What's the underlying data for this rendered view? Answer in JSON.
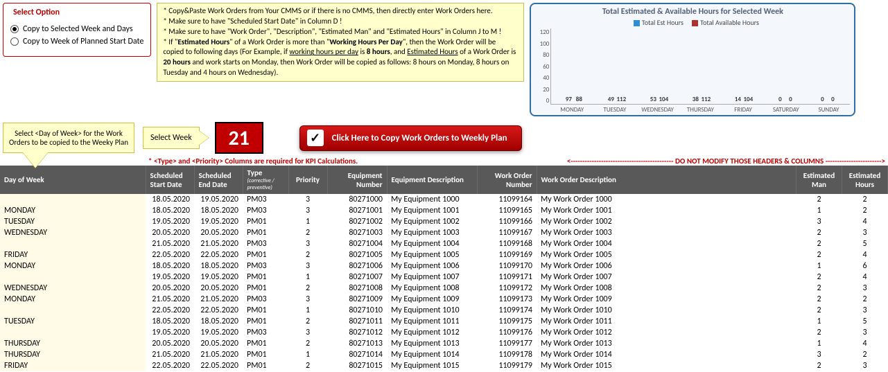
{
  "option_box": {
    "legend": "Select Option",
    "opt1": "Copy to Selected Week and Days",
    "opt2": "Copy to Week of Planned Start Date"
  },
  "instructions": {
    "l1": "* Copy&Paste Work Orders from Your CMMS or if there is no CMMS, then directly enter Work Orders here.",
    "l2": "* Make sure to have \"Scheduled Start Date\" in Column D !",
    "l3": "* Make sure to have \"Work Order\", \"Description\", \"Estimated Man\" and \"Estimated Hours\" in Column J to M !",
    "l4a": "* If \"",
    "l4b": "Estimated Hours",
    "l4c": "\" of a Work Order is more than \"",
    "l4d": "Working Hours Per Day",
    "l4e": "\", then the Work Order will be copied to following days (For Example, if ",
    "l4f": "working hours per day",
    "l4g": " is ",
    "l4h": "8 hours",
    "l4i": ", and ",
    "l4j": "Estimated Hours",
    "l4k": " of a Work Order is ",
    "l4l": "20 hours",
    "l4m": " and work starts on Monday, then Work Order will be copied as follows: 8 hours on Monday, 8 hours on Tuesday and 4 hours on Wednesday)."
  },
  "chart": {
    "title": "Total Estimated & Available Hours for Selected Week",
    "legend_a": "Total Est Hours",
    "legend_b": "Total Available Hours"
  },
  "chart_data": {
    "type": "bar",
    "categories": [
      "MONDAY",
      "TUESDAY",
      "WEDNESDAY",
      "THURSDAY",
      "FRIDAY",
      "SATURDAY",
      "SUNDAY"
    ],
    "series": [
      {
        "name": "Total Est Hours",
        "values": [
          97,
          49,
          53,
          38,
          14,
          0,
          0
        ],
        "color": "#2f8fd6"
      },
      {
        "name": "Total Available Hours",
        "values": [
          88,
          112,
          104,
          112,
          104,
          0,
          0
        ],
        "color": "#b03030"
      }
    ],
    "ylim": [
      0,
      120
    ],
    "yticks": [
      0,
      20,
      40,
      60,
      80,
      100,
      120
    ]
  },
  "day_arrow": "Select <Day of Week> for the Work Orders to be copied to the Weeky Plan",
  "select_week_label": "Select Week",
  "week_number": "21",
  "big_button": "Click Here to Copy Work Orders to Weekly Plan",
  "warn_left": "* <Type> and <Priority> Columns are required for KPI Calculations.",
  "warn_right_dash_l": "<--------------------------------------------",
  "warn_right_text": " DO NOT MODIFY THOSE HEADERS & COLUMNS ",
  "warn_right_dash_r": "------------------------>",
  "headers": {
    "day": "Day of Week",
    "ssd": "Scheduled Start Date",
    "sed": "Scheduled End Date",
    "type": "Type",
    "type_sub": "(corrective / preventive)",
    "prio": "Priority",
    "eqn": "Equipment Number",
    "eqd": "Equipment Description",
    "won": "Work Order Number",
    "wod": "Work Order Description",
    "man": "Estimated Man",
    "hrs": "Estimated Hours"
  },
  "rows": [
    {
      "day": "",
      "ssd": "18.05.2020",
      "sed": "19.05.2020",
      "type": "PM03",
      "prio": "3",
      "eqn": "80271000",
      "eqd": "My Equipment 1000",
      "won": "11099164",
      "wod": "My Work Order 1000",
      "man": "2",
      "hrs": "2"
    },
    {
      "day": "MONDAY",
      "ssd": "18.05.2020",
      "sed": "18.05.2020",
      "type": "PM03",
      "prio": "3",
      "eqn": "80271001",
      "eqd": "My Equipment 1001",
      "won": "11099165",
      "wod": "My Work Order 1001",
      "man": "1",
      "hrs": "2"
    },
    {
      "day": "TUESDAY",
      "ssd": "19.05.2020",
      "sed": "19.05.2020",
      "type": "PM01",
      "prio": "1",
      "eqn": "80271002",
      "eqd": "My Equipment 1002",
      "won": "11099166",
      "wod": "My Work Order 1002",
      "man": "3",
      "hrs": "4"
    },
    {
      "day": "WEDNESDAY",
      "ssd": "20.05.2020",
      "sed": "20.05.2020",
      "type": "PM01",
      "prio": "2",
      "eqn": "80271003",
      "eqd": "My Equipment 1003",
      "won": "11099167",
      "wod": "My Work Order 1003",
      "man": "2",
      "hrs": "3"
    },
    {
      "day": "",
      "ssd": "21.05.2020",
      "sed": "21.05.2020",
      "type": "PM03",
      "prio": "3",
      "eqn": "80271004",
      "eqd": "My Equipment 1004",
      "won": "11099168",
      "wod": "My Work Order 1004",
      "man": "2",
      "hrs": "5"
    },
    {
      "day": "FRIDAY",
      "ssd": "22.05.2020",
      "sed": "22.05.2020",
      "type": "PM01",
      "prio": "2",
      "eqn": "80271005",
      "eqd": "My Equipment 1005",
      "won": "11099169",
      "wod": "My Work Order 1005",
      "man": "2",
      "hrs": "4"
    },
    {
      "day": "MONDAY",
      "ssd": "18.05.2020",
      "sed": "18.05.2020",
      "type": "PM03",
      "prio": "3",
      "eqn": "80271006",
      "eqd": "My Equipment 1006",
      "won": "11099170",
      "wod": "My Work Order 1006",
      "man": "1",
      "hrs": "6"
    },
    {
      "day": "",
      "ssd": "19.05.2020",
      "sed": "19.05.2020",
      "type": "PM01",
      "prio": "1",
      "eqn": "80271007",
      "eqd": "My Equipment 1007",
      "won": "11099171",
      "wod": "My Work Order 1007",
      "man": "2",
      "hrs": "4"
    },
    {
      "day": "WEDNESDAY",
      "ssd": "20.05.2020",
      "sed": "20.05.2020",
      "type": "PM01",
      "prio": "2",
      "eqn": "80271008",
      "eqd": "My Equipment 1008",
      "won": "11099172",
      "wod": "My Work Order 1008",
      "man": "2",
      "hrs": "3"
    },
    {
      "day": "MONDAY",
      "ssd": "21.05.2020",
      "sed": "21.05.2020",
      "type": "PM03",
      "prio": "3",
      "eqn": "80271009",
      "eqd": "My Equipment 1009",
      "won": "11099173",
      "wod": "My Work Order 1009",
      "man": "2",
      "hrs": "2"
    },
    {
      "day": "",
      "ssd": "22.05.2020",
      "sed": "22.05.2020",
      "type": "PM01",
      "prio": "1",
      "eqn": "80271010",
      "eqd": "My Equipment 1010",
      "won": "11099174",
      "wod": "My Work Order 1010",
      "man": "2",
      "hrs": "3"
    },
    {
      "day": "TUESDAY",
      "ssd": "18.05.2020",
      "sed": "18.05.2020",
      "type": "PM01",
      "prio": "2",
      "eqn": "80271011",
      "eqd": "My Equipment 1011",
      "won": "11099175",
      "wod": "My Work Order 1011",
      "man": "1",
      "hrs": "5"
    },
    {
      "day": "",
      "ssd": "19.05.2020",
      "sed": "19.05.2020",
      "type": "PM03",
      "prio": "3",
      "eqn": "80271012",
      "eqd": "My Equipment 1012",
      "won": "11099176",
      "wod": "My Work Order 1012",
      "man": "2",
      "hrs": "3"
    },
    {
      "day": "THURSDAY",
      "ssd": "20.05.2020",
      "sed": "20.05.2020",
      "type": "PM01",
      "prio": "2",
      "eqn": "80271013",
      "eqd": "My Equipment 1013",
      "won": "11099177",
      "wod": "My Work Order 1013",
      "man": "1",
      "hrs": "4"
    },
    {
      "day": "THURSDAY",
      "ssd": "21.05.2020",
      "sed": "21.05.2020",
      "type": "PM01",
      "prio": "1",
      "eqn": "80271014",
      "eqd": "My Equipment 1014",
      "won": "11099178",
      "wod": "My Work Order 1014",
      "man": "3",
      "hrs": "2"
    },
    {
      "day": "FRIDAY",
      "ssd": "22.05.2020",
      "sed": "22.05.2020",
      "type": "PM01",
      "prio": "2",
      "eqn": "80271015",
      "eqd": "My Equipment 1015",
      "won": "11099179",
      "wod": "My Work Order 1015",
      "man": "2",
      "hrs": "3"
    }
  ]
}
